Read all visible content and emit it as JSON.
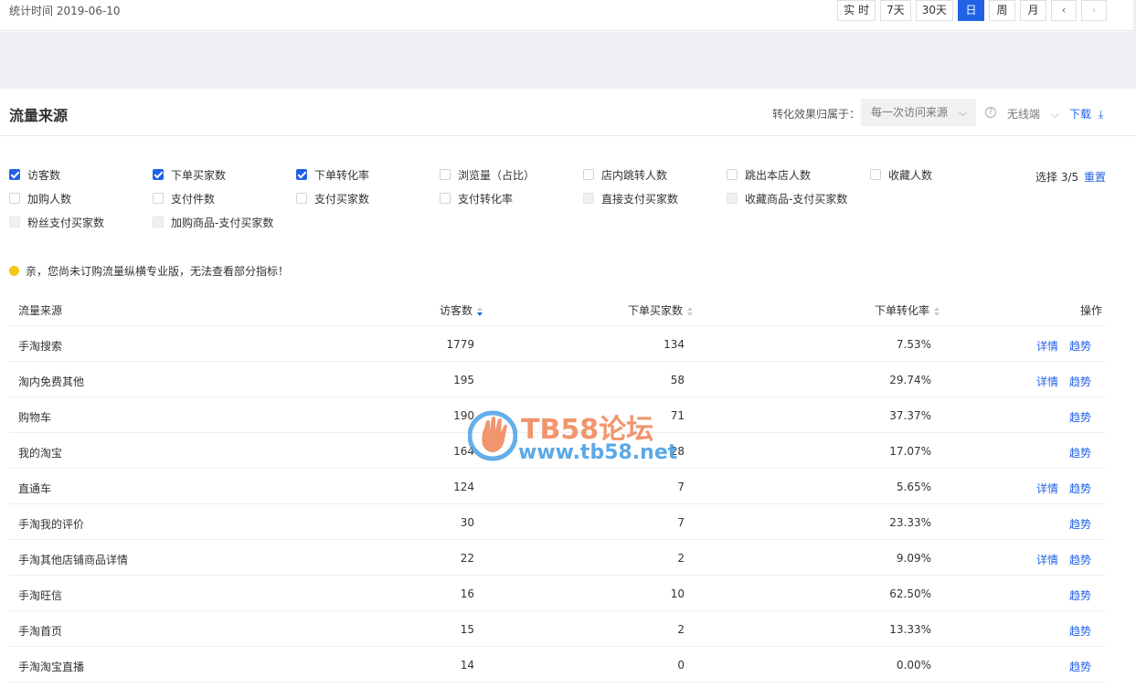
{
  "header": {
    "stat_time": "统计时间 2019-06-10",
    "date_buttons": [
      {
        "label": "实 时",
        "active": false
      },
      {
        "label": "7天",
        "active": false
      },
      {
        "label": "30天",
        "active": false
      },
      {
        "label": "日",
        "active": true
      },
      {
        "label": "周",
        "active": false
      },
      {
        "label": "月",
        "active": false
      }
    ],
    "prev_icon": "chevron-left-icon",
    "next_icon": "chevron-right-icon"
  },
  "section": {
    "title": "流量来源",
    "attribution_label": "转化效果归属于：",
    "attribution_value": "每一次访问来源",
    "device_value": "无线端",
    "download_label": "下载"
  },
  "metrics": {
    "items": [
      {
        "label": "访客数",
        "state": "checked"
      },
      {
        "label": "下单买家数",
        "state": "checked"
      },
      {
        "label": "下单转化率",
        "state": "checked"
      },
      {
        "label": "浏览量（占比）",
        "state": "unchecked"
      },
      {
        "label": "店内跳转人数",
        "state": "unchecked"
      },
      {
        "label": "跳出本店人数",
        "state": "unchecked"
      },
      {
        "label": "收藏人数",
        "state": "unchecked"
      },
      {
        "label": "加购人数",
        "state": "unchecked"
      },
      {
        "label": "支付件数",
        "state": "unchecked"
      },
      {
        "label": "支付买家数",
        "state": "unchecked"
      },
      {
        "label": "支付转化率",
        "state": "unchecked"
      },
      {
        "label": "直接支付买家数",
        "state": "disabled"
      },
      {
        "label": "收藏商品-支付买家数",
        "state": "disabled"
      },
      {
        "label": "粉丝支付买家数",
        "state": "disabled"
      },
      {
        "label": "加购商品-支付买家数",
        "state": "disabled"
      }
    ],
    "select_count": "选择 3/5",
    "reset_label": "重置"
  },
  "notice": "亲，您尚未订购流量纵横专业版，无法查看部分指标！",
  "table": {
    "headers": {
      "source": "流量来源",
      "visitors": "访客数",
      "buyers": "下单买家数",
      "rate": "下单转化率",
      "ops": "操作"
    },
    "rows": [
      {
        "source": "手淘搜索",
        "visitors": "1779",
        "buyers": "134",
        "rate": "7.53%",
        "detail": true
      },
      {
        "source": "淘内免费其他",
        "visitors": "195",
        "buyers": "58",
        "rate": "29.74%",
        "detail": true
      },
      {
        "source": "购物车",
        "visitors": "190",
        "buyers": "71",
        "rate": "37.37%",
        "detail": false
      },
      {
        "source": "我的淘宝",
        "visitors": "164",
        "buyers": "28",
        "rate": "17.07%",
        "detail": false
      },
      {
        "source": "直通车",
        "visitors": "124",
        "buyers": "7",
        "rate": "5.65%",
        "detail": true
      },
      {
        "source": "手淘我的评价",
        "visitors": "30",
        "buyers": "7",
        "rate": "23.33%",
        "detail": false
      },
      {
        "source": "手淘其他店铺商品详情",
        "visitors": "22",
        "buyers": "2",
        "rate": "9.09%",
        "detail": true
      },
      {
        "source": "手淘旺信",
        "visitors": "16",
        "buyers": "10",
        "rate": "62.50%",
        "detail": false
      },
      {
        "source": "手淘首页",
        "visitors": "15",
        "buyers": "2",
        "rate": "13.33%",
        "detail": false
      },
      {
        "source": "手淘淘宝直播",
        "visitors": "14",
        "buyers": "0",
        "rate": "0.00%",
        "detail": false
      }
    ],
    "detail_label": "详情",
    "trend_label": "趋势"
  },
  "watermark": {
    "title": "TB58论坛",
    "url": "www.tb58.net"
  }
}
